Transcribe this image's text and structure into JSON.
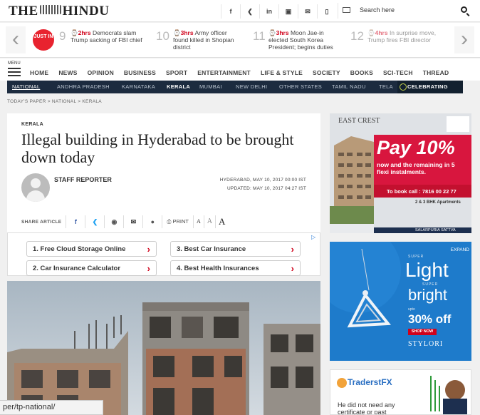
{
  "header": {
    "logo": "THE HINDU",
    "social_icons": [
      "facebook-icon",
      "twitter-icon",
      "linkedin-icon",
      "instagram-icon",
      "mail-icon",
      "mobile-icon"
    ],
    "search_placeholder": "Search here"
  },
  "just_in": {
    "badge": "JUST IN",
    "items": [
      {
        "num": "9",
        "time": "2hrs",
        "text": "Democrats slam Trump sacking of FBI chief"
      },
      {
        "num": "10",
        "time": "3hrs",
        "text": "Army officer found killed in Shopian district"
      },
      {
        "num": "11",
        "time": "3hrs",
        "text": "Moon Jae-in elected South Korea President; begins duties"
      },
      {
        "num": "12",
        "time": "4hrs",
        "text": "In surprise move, Trump fires FBI director"
      }
    ]
  },
  "nav": {
    "menu_label": "MENU",
    "items": [
      "HOME",
      "NEWS",
      "OPINION",
      "BUSINESS",
      "SPORT",
      "ENTERTAINMENT",
      "LIFE & STYLE",
      "SOCIETY",
      "BOOKS",
      "SCI-TECH",
      "THREAD"
    ]
  },
  "subnav": {
    "items": [
      "NATIONAL",
      "ANDHRA PRADESH",
      "KARNATAKA",
      "KERALA",
      "MUMBAI",
      "NEW DELHI",
      "OTHER STATES",
      "TAMIL NADU",
      "TELA"
    ],
    "active": "KERALA",
    "celebrating": "CELEBRATING"
  },
  "breadcrumb": "TODAY'S PAPER  >  NATIONAL  >  KERALA",
  "article": {
    "kicker": "KERALA",
    "headline": "Illegal building in Hyderabad to be brought down today",
    "author": "STAFF REPORTER",
    "dateline": "HYDERABAD, MAY 10, 2017 00:00 IST",
    "updated": "UPDATED: MAY 10, 2017 04:27 IST",
    "share_label": "SHARE ARTICLE",
    "print_label": "PRINT",
    "font_sizes": [
      "A",
      "A",
      "A"
    ]
  },
  "ad_links": [
    "1.  Free Cloud Storage Online",
    "3.  Best Car Insurance",
    "2.  Car Insurance Calculator",
    "4.  Best Health Insurances"
  ],
  "ads": {
    "ad1": {
      "brand": "EAST CREST",
      "headline": "Pay 10%",
      "sub": "now and the remaining in 5 flexi instalments.",
      "call": "To book call : 7816 00 22 77",
      "apts": "2 & 3 BHK Apartments",
      "developer": "SALARPURIA SATTVA"
    },
    "ad2": {
      "expand": "EXPAND",
      "super1": "SUPER",
      "light": "Light",
      "super2": "SUPER",
      "bright": "bright",
      "upto": "upto",
      "off": "30% off",
      "shop": "SHOP NOW",
      "brand": "STYLORI"
    },
    "ad3": {
      "brand": "TraderstFX",
      "text": "He did not need any certificate or past"
    }
  },
  "status_url": "per/tp-national/"
}
